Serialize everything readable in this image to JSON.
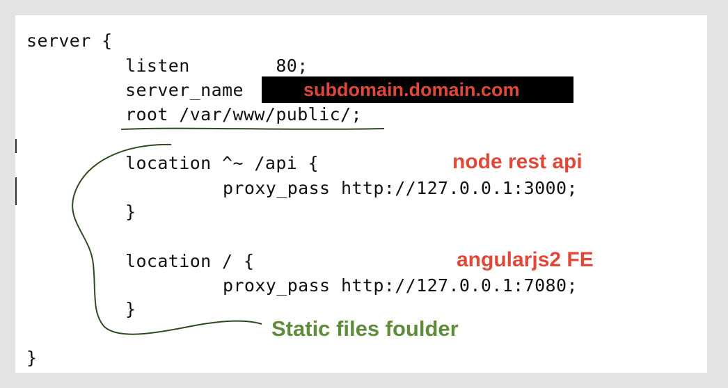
{
  "code": {
    "line_server_open": "server {",
    "line_listen": "listen        80;",
    "line_server_name": "server_name",
    "line_root": "root /var/www/public/;",
    "line_location_api": "location ^~ /api {",
    "line_proxy_api": "proxy_pass http://127.0.0.1:3000;",
    "line_close_api": "}",
    "line_location_root": "location / {",
    "line_proxy_root": "proxy_pass http://127.0.0.1:7080;",
    "line_close_root": "}",
    "line_server_close": "}"
  },
  "annotations": {
    "domain_label": "subdomain.domain.com",
    "node_api_label": "node rest api",
    "angular_label": "angularjs2 FE",
    "static_label": "Static files foulder"
  },
  "colors": {
    "red_annotation": "#e0493a",
    "green_annotation": "#5f8c3a",
    "redaction": "#000000"
  }
}
